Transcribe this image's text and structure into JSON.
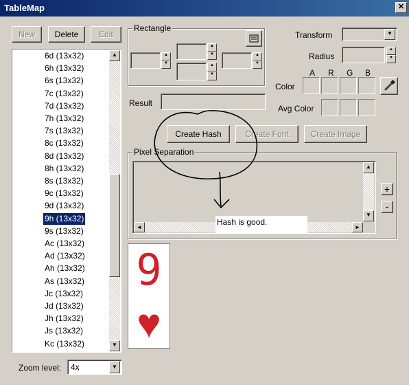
{
  "window": {
    "title": "TableMap",
    "close_label": "✕"
  },
  "toolbar": {
    "new_label": "New",
    "delete_label": "Delete",
    "edit_label": "Edit"
  },
  "list": {
    "items": [
      "6d (13x32)",
      "6h (13x32)",
      "6s (13x32)",
      "7c (13x32)",
      "7d (13x32)",
      "7h (13x32)",
      "7s (13x32)",
      "8c (13x32)",
      "8d (13x32)",
      "8h (13x32)",
      "8s (13x32)",
      "9c (13x32)",
      "9d (13x32)",
      "9h (13x32)",
      "9s (13x32)",
      "Ac (13x32)",
      "Ad (13x32)",
      "Ah (13x32)",
      "As (13x32)",
      "Jc (13x32)",
      "Jd (13x32)",
      "Jh (13x32)",
      "Js (13x32)",
      "Kc (13x32)"
    ],
    "selected_index": 13
  },
  "zoom": {
    "label": "Zoom level:",
    "value": "4x"
  },
  "rectangle": {
    "legend": "Rectangle"
  },
  "transform": {
    "label": "Transform",
    "value": ""
  },
  "radius": {
    "label": "Radius",
    "value": ""
  },
  "color": {
    "label": "Color",
    "headers": [
      "A",
      "R",
      "G",
      "B"
    ]
  },
  "avg_color": {
    "label": "Avg Color"
  },
  "result": {
    "label": "Result",
    "value": ""
  },
  "actions": {
    "create_hash": "Create Hash",
    "create_font": "Create Font",
    "create_image": "Create Image"
  },
  "pixel_separation": {
    "legend": "Pixel Separation",
    "plus": "+",
    "minus": "-"
  },
  "annotation": {
    "text": "Hash is good."
  },
  "preview": {
    "glyph": "9",
    "suit": "♥",
    "color": "#d0202a"
  }
}
